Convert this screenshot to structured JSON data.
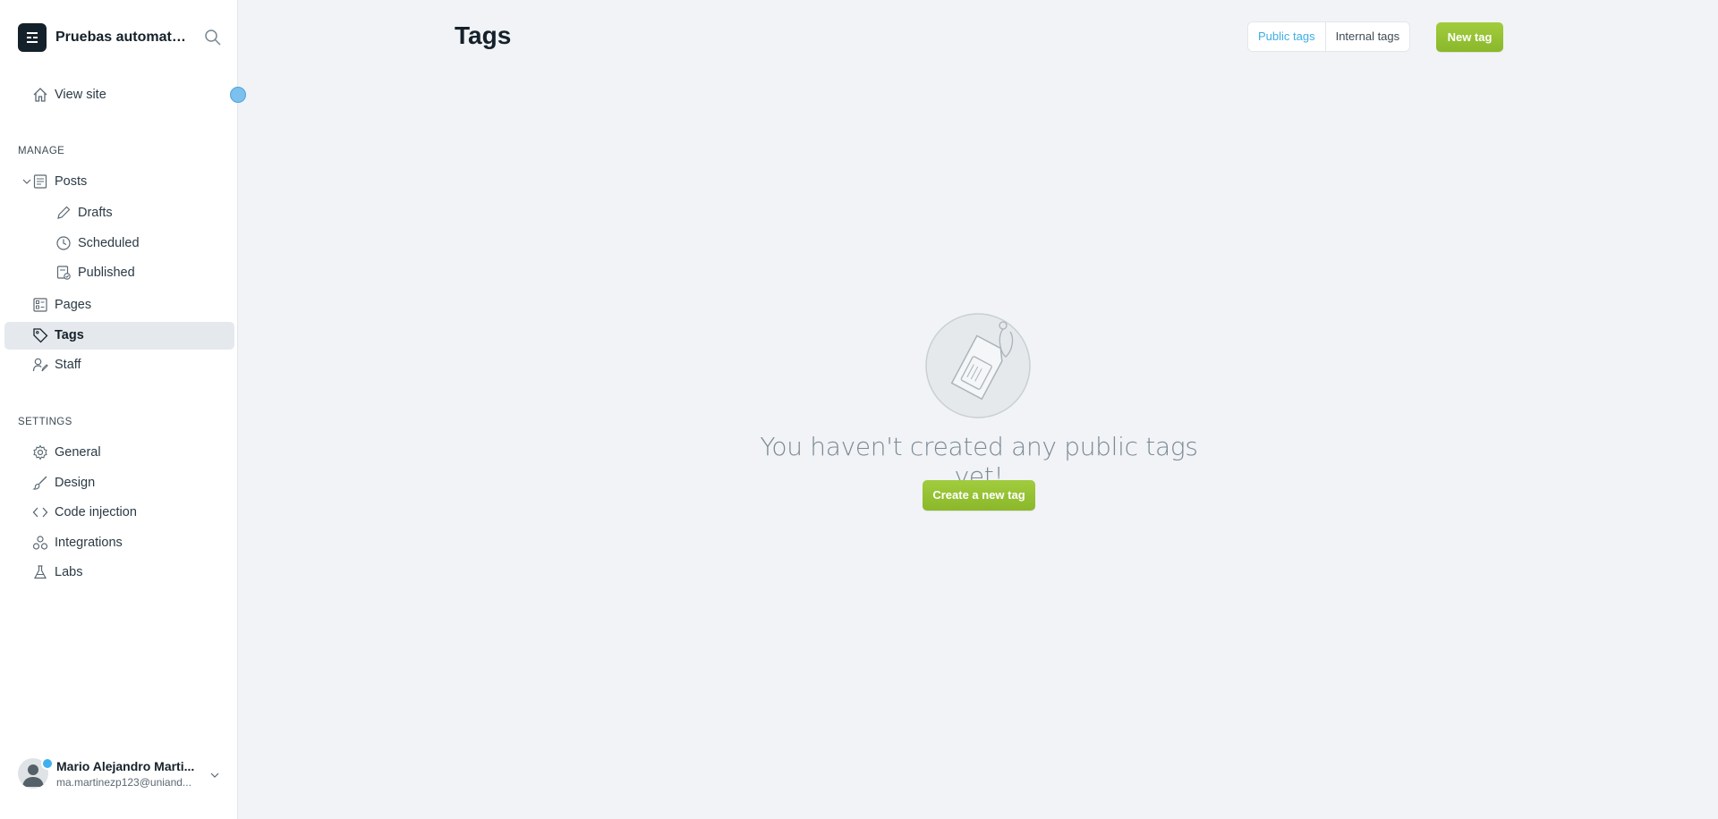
{
  "brand": {
    "name": "Pruebas automatiz..."
  },
  "sidebar": {
    "view_site": "View site",
    "manage_header": "MANAGE",
    "settings_header": "SETTINGS",
    "posts": "Posts",
    "drafts": "Drafts",
    "scheduled": "Scheduled",
    "published": "Published",
    "pages": "Pages",
    "tags": "Tags",
    "staff": "Staff",
    "general": "General",
    "design": "Design",
    "code_injection": "Code injection",
    "integrations": "Integrations",
    "labs": "Labs",
    "active_item": "Tags"
  },
  "user": {
    "name": "Mario Alejandro Marti...",
    "email": "ma.martinezp123@uniand..."
  },
  "header": {
    "title": "Tags",
    "tab_public": "Public tags",
    "tab_internal": "Internal tags",
    "selected_tab": "Public tags",
    "new_tag_label": "New tag"
  },
  "empty_state": {
    "message": "You haven't created any public tags yet!",
    "create_label": "Create a new tag"
  },
  "colors": {
    "accent_green": "#93be32",
    "link_blue": "#3eaee5",
    "sidebar_bg": "#ffffff",
    "main_bg": "#f1f3f6"
  },
  "icons": [
    "search-icon",
    "home-icon",
    "posts-icon",
    "pencil-icon",
    "clock-icon",
    "published-icon",
    "pages-icon",
    "tag-icon",
    "staff-icon",
    "gear-icon",
    "brush-icon",
    "code-icon",
    "integrations-icon",
    "flask-icon",
    "chevron-down-icon"
  ]
}
